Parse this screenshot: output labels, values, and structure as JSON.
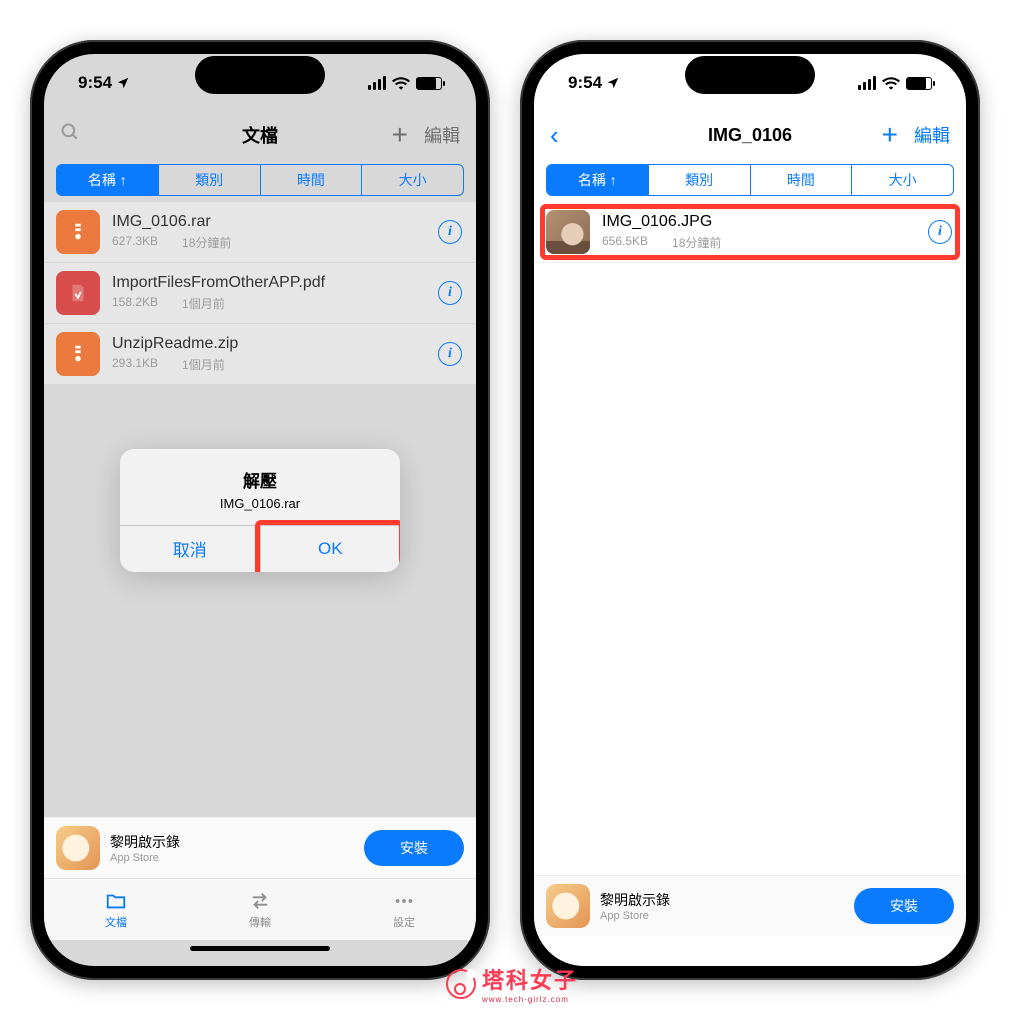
{
  "status": {
    "time": "9:54",
    "location_arrow": "◢"
  },
  "left": {
    "nav": {
      "title": "文檔",
      "add": "+",
      "edit": "編輯"
    },
    "segments": [
      "名稱 ↑",
      "類別",
      "時間",
      "大小"
    ],
    "files": [
      {
        "name": "IMG_0106.rar",
        "size": "627.3KB",
        "when": "18分鐘前",
        "kind": "rar"
      },
      {
        "name": "ImportFilesFromOtherAPP.pdf",
        "size": "158.2KB",
        "when": "1個月前",
        "kind": "pdf"
      },
      {
        "name": "UnzipReadme.zip",
        "size": "293.1KB",
        "when": "1個月前",
        "kind": "zip"
      }
    ],
    "alert": {
      "title": "解壓",
      "message": "IMG_0106.rar",
      "cancel": "取消",
      "ok": "OK"
    },
    "ad": {
      "title": "黎明啟示錄",
      "sub": "App Store",
      "cta": "安裝"
    },
    "tabs": {
      "docs": "文檔",
      "transfer": "傳輸",
      "settings": "設定"
    }
  },
  "right": {
    "nav": {
      "title": "IMG_0106",
      "add": "+",
      "edit": "編輯"
    },
    "segments": [
      "名稱 ↑",
      "類別",
      "時間",
      "大小"
    ],
    "files": [
      {
        "name": "IMG_0106.JPG",
        "size": "656.5KB",
        "when": "18分鐘前",
        "kind": "jpg"
      }
    ],
    "ad": {
      "title": "黎明啟示錄",
      "sub": "App Store",
      "cta": "安裝"
    }
  },
  "watermark": {
    "text": "塔科女子",
    "sub": "www.tech-girlz.com"
  }
}
